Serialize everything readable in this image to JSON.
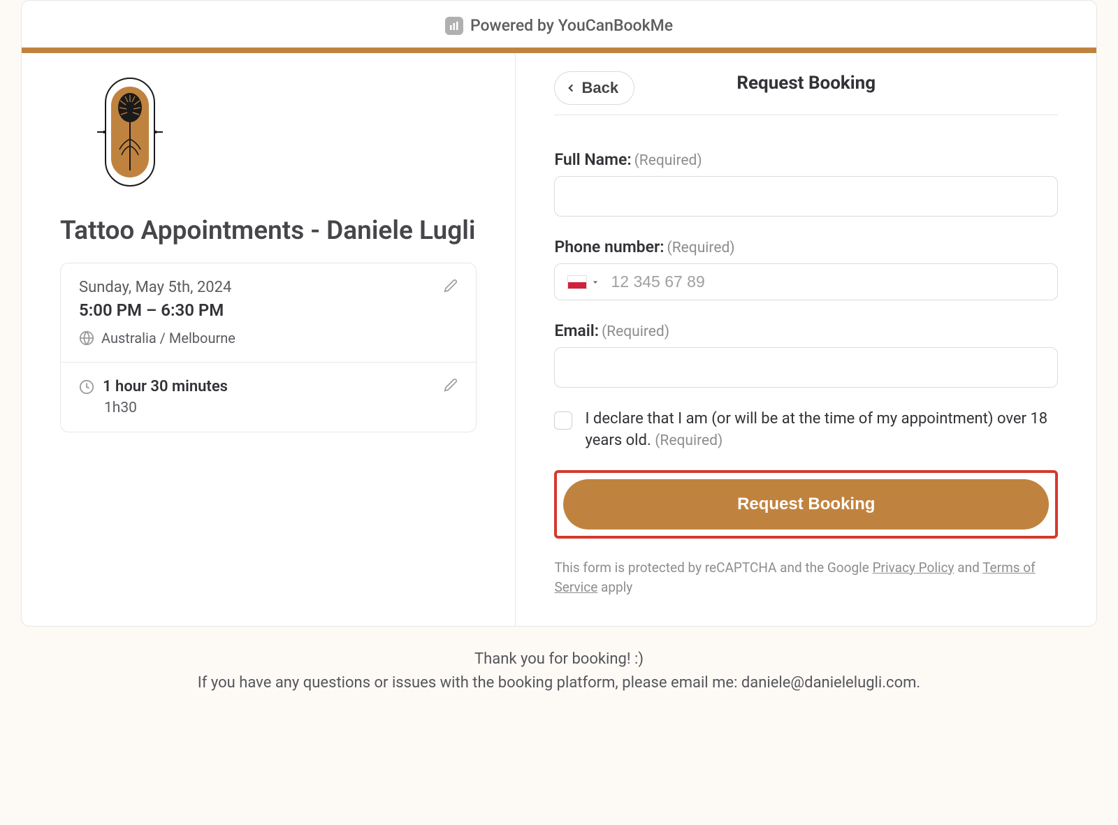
{
  "colors": {
    "accent": "#c0833f",
    "highlight_border": "#d33a2b"
  },
  "powered": {
    "label": "Powered by YouCanBookMe"
  },
  "left": {
    "title": "Tattoo Appointments - Daniele Lugli",
    "date": "Sunday, May 5th, 2024",
    "time_range": "5:00 PM – 6:30 PM",
    "timezone": "Australia / Melbourne",
    "duration_label": "1 hour 30 minutes",
    "duration_short": "1h30"
  },
  "header": {
    "back_label": "Back",
    "title": "Request Booking"
  },
  "form": {
    "fullname_label": "Full Name:",
    "phone_label": "Phone number:",
    "phone_placeholder": "12 345 67 89",
    "email_label": "Email:",
    "required_text": "(Required)",
    "declaration_text": "I declare that I am (or will be at the time of my appointment) over 18 years old.",
    "submit_label": "Request Booking"
  },
  "recaptcha": {
    "prefix": "This form is protected by reCAPTCHA and the Google ",
    "privacy_label": "Privacy Policy",
    "mid": " and ",
    "terms_label": "Terms of Service",
    "suffix": " apply"
  },
  "footer": {
    "line1": "Thank you for booking! :)",
    "line2": "If you have any questions or issues with the booking platform, please email me: daniele@danielelugli.com."
  }
}
